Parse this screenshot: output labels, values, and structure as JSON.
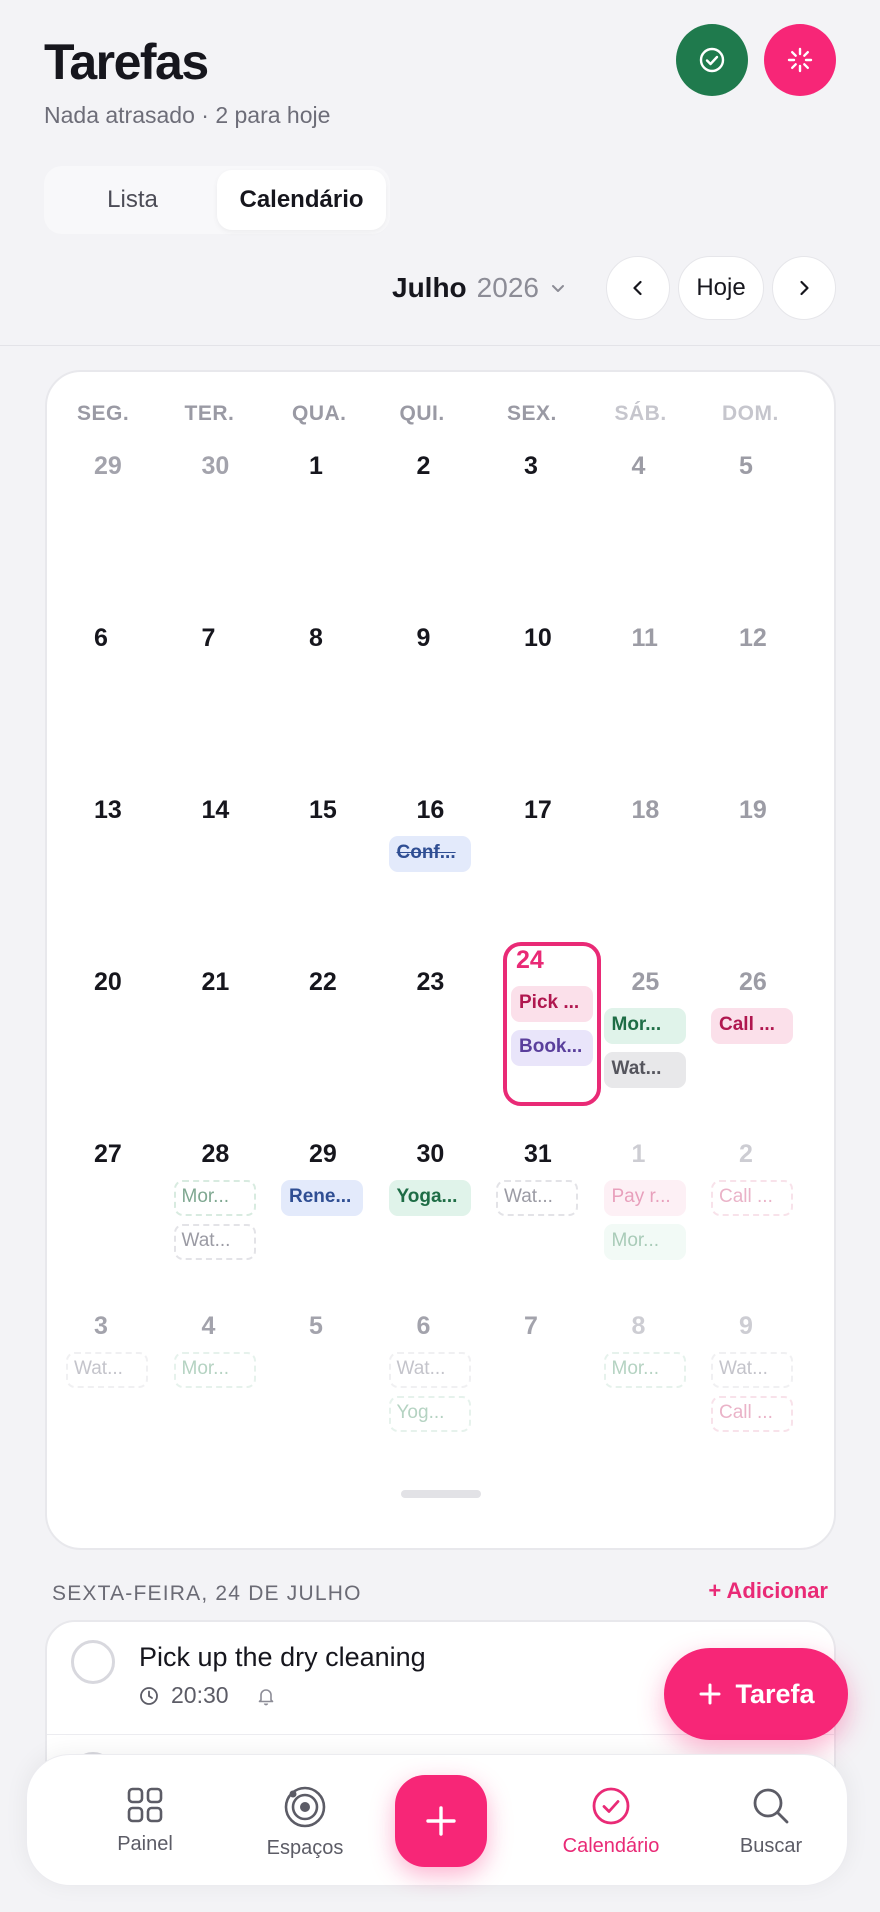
{
  "header": {
    "title": "Tarefas",
    "subtitle": "Nada atrasado · 2 para hoje"
  },
  "segments": [
    {
      "label": "Lista",
      "active": false
    },
    {
      "label": "Calendário",
      "active": true
    }
  ],
  "month_nav": {
    "month": "Julho",
    "year": "2026",
    "today_label": "Hoje"
  },
  "weekdays": [
    "SEG.",
    "TER.",
    "QUA.",
    "QUI.",
    "SEX.",
    "SÁB.",
    "DOM."
  ],
  "weeks": [
    [
      {
        "n": "29",
        "other": true
      },
      {
        "n": "30",
        "other": true
      },
      {
        "n": "1"
      },
      {
        "n": "2"
      },
      {
        "n": "3"
      },
      {
        "n": "4"
      },
      {
        "n": "5"
      }
    ],
    [
      {
        "n": "6"
      },
      {
        "n": "7"
      },
      {
        "n": "8"
      },
      {
        "n": "9"
      },
      {
        "n": "10"
      },
      {
        "n": "11"
      },
      {
        "n": "12"
      }
    ],
    [
      {
        "n": "13"
      },
      {
        "n": "14"
      },
      {
        "n": "15"
      },
      {
        "n": "16",
        "chips": [
          {
            "t": "Conf...",
            "s": "blue strike"
          }
        ]
      },
      {
        "n": "17"
      },
      {
        "n": "18"
      },
      {
        "n": "19"
      }
    ],
    [
      {
        "n": "20"
      },
      {
        "n": "21"
      },
      {
        "n": "22"
      },
      {
        "n": "23"
      },
      {
        "n": "24",
        "today": true,
        "chips": [
          {
            "t": "Pick ...",
            "s": "pink"
          },
          {
            "t": "Book...",
            "s": "purple"
          }
        ]
      },
      {
        "n": "25",
        "chips": [
          {
            "t": "Mor...",
            "s": "green"
          },
          {
            "t": "Wat...",
            "s": "gray"
          }
        ]
      },
      {
        "n": "26",
        "chips": [
          {
            "t": "Call ...",
            "s": "pink"
          }
        ]
      }
    ],
    [
      {
        "n": "27"
      },
      {
        "n": "28",
        "chips": [
          {
            "t": "Mor...",
            "s": "mid-dash-green"
          },
          {
            "t": "Wat...",
            "s": "dash"
          }
        ]
      },
      {
        "n": "29",
        "chips": [
          {
            "t": "Rene...",
            "s": "blue"
          }
        ]
      },
      {
        "n": "30",
        "chips": [
          {
            "t": "Yoga...",
            "s": "green"
          }
        ]
      },
      {
        "n": "31",
        "chips": [
          {
            "t": "Wat...",
            "s": "dash"
          }
        ]
      },
      {
        "n": "1",
        "other": true,
        "chips": [
          {
            "t": "Pay r...",
            "s": "faint-pink"
          },
          {
            "t": "Mor...",
            "s": "faint-green"
          }
        ]
      },
      {
        "n": "2",
        "other": true,
        "chips": [
          {
            "t": "Call ...",
            "s": "faint-dash-pink"
          }
        ]
      }
    ],
    [
      {
        "n": "3",
        "other": true,
        "chips": [
          {
            "t": "Wat...",
            "s": "faint-dash"
          }
        ]
      },
      {
        "n": "4",
        "other": true,
        "chips": [
          {
            "t": "Mor...",
            "s": "faint-dash-green"
          }
        ]
      },
      {
        "n": "5",
        "other": true
      },
      {
        "n": "6",
        "other": true,
        "chips": [
          {
            "t": "Wat...",
            "s": "faint-dash"
          },
          {
            "t": "Yog...",
            "s": "faint-dash-green"
          }
        ]
      },
      {
        "n": "7",
        "other": true
      },
      {
        "n": "8",
        "other": true,
        "chips": [
          {
            "t": "Mor...",
            "s": "faint-dash-green"
          }
        ]
      },
      {
        "n": "9",
        "other": true,
        "chips": [
          {
            "t": "Wat...",
            "s": "faint-dash"
          },
          {
            "t": "Call ...",
            "s": "faint-dash-pink"
          }
        ]
      }
    ]
  ],
  "selected_day": {
    "heading": "SEXTA-FEIRA, 24 DE JULHO",
    "add_label": "+ Adicionar",
    "tasks": [
      {
        "title": "Pick up the dry cleaning",
        "time": "20:30"
      }
    ]
  },
  "fab": {
    "label": "Tarefa"
  },
  "tabbar": [
    {
      "label": "Painel",
      "icon": "grid-icon"
    },
    {
      "label": "Espaços",
      "icon": "orbit-icon"
    },
    {
      "label": "Calendário",
      "icon": "check-circle-icon",
      "active": true
    },
    {
      "label": "Buscar",
      "icon": "search-icon"
    }
  ],
  "colors": {
    "accent": "#f72677",
    "success": "#1f7a4d",
    "today": "#e92a76"
  }
}
